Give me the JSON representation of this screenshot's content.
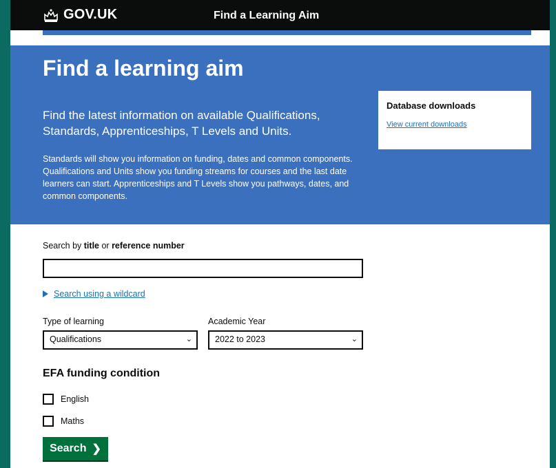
{
  "colors": {
    "outer": "#0b6b63",
    "hero": "#3a70bd",
    "link": "#1d70b8",
    "button": "#00703c",
    "topbar": "#0b0c0c"
  },
  "header": {
    "logo_text": "GOV.UK",
    "logo_icon": "crown-icon",
    "service_name": "Find a Learning Aim"
  },
  "hero": {
    "title": "Find a learning aim",
    "lead": "Find the latest information on available Qualifications, Standards, Apprenticeships, T Levels and Units.",
    "body": "Standards will show you information on funding, dates and common components. Qualifications and Units show you funding streams for courses and the last date learners can start. Apprenticeships and T Levels show you pathways, dates, and common components."
  },
  "downloads": {
    "heading": "Database downloads",
    "link": "View current downloads"
  },
  "search": {
    "label_prefix": "Search by ",
    "label_title": "title",
    "label_or": " or ",
    "label_ref": "reference number",
    "value": "",
    "wildcard_link": "Search using a wildcard"
  },
  "filters": {
    "type_label": "Type of learning",
    "type_value": "Qualifications",
    "year_label": "Academic Year",
    "year_value": "2022 to 2023"
  },
  "efa": {
    "title": "EFA funding condition",
    "options": [
      {
        "label": "English",
        "checked": false
      },
      {
        "label": "Maths",
        "checked": false
      }
    ]
  },
  "actions": {
    "search_label": "Search"
  }
}
